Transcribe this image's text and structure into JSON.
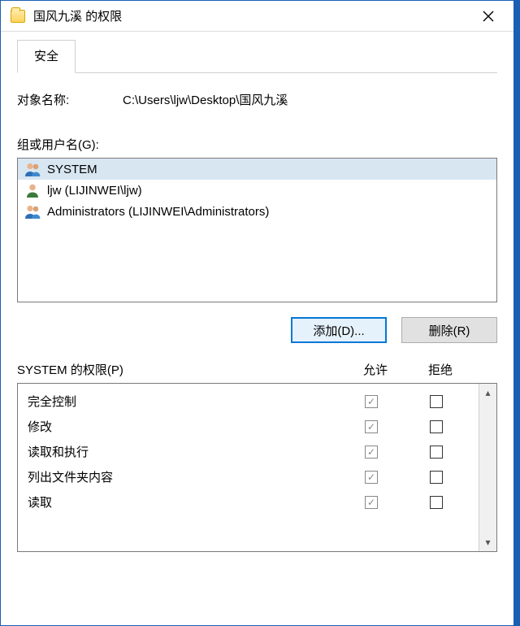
{
  "window": {
    "title": "国风九溪 的权限"
  },
  "tabs": {
    "security": "安全"
  },
  "object": {
    "label": "对象名称:",
    "path": "C:\\Users\\ljw\\Desktop\\国风九溪"
  },
  "groups": {
    "label": "组或用户名(G):",
    "items": [
      {
        "name": "SYSTEM",
        "type": "group",
        "selected": true
      },
      {
        "name": "ljw (LIJINWEI\\ljw)",
        "type": "user",
        "selected": false
      },
      {
        "name": "Administrators (LIJINWEI\\Administrators)",
        "type": "group",
        "selected": false
      }
    ]
  },
  "buttons": {
    "add": "添加(D)...",
    "remove": "删除(R)"
  },
  "permissions": {
    "title": "SYSTEM 的权限(P)",
    "col_allow": "允许",
    "col_deny": "拒绝",
    "rows": [
      {
        "name": "完全控制",
        "allow": true,
        "deny": false
      },
      {
        "name": "修改",
        "allow": true,
        "deny": false
      },
      {
        "name": "读取和执行",
        "allow": true,
        "deny": false
      },
      {
        "name": "列出文件夹内容",
        "allow": true,
        "deny": false
      },
      {
        "name": "读取",
        "allow": true,
        "deny": false
      }
    ]
  }
}
